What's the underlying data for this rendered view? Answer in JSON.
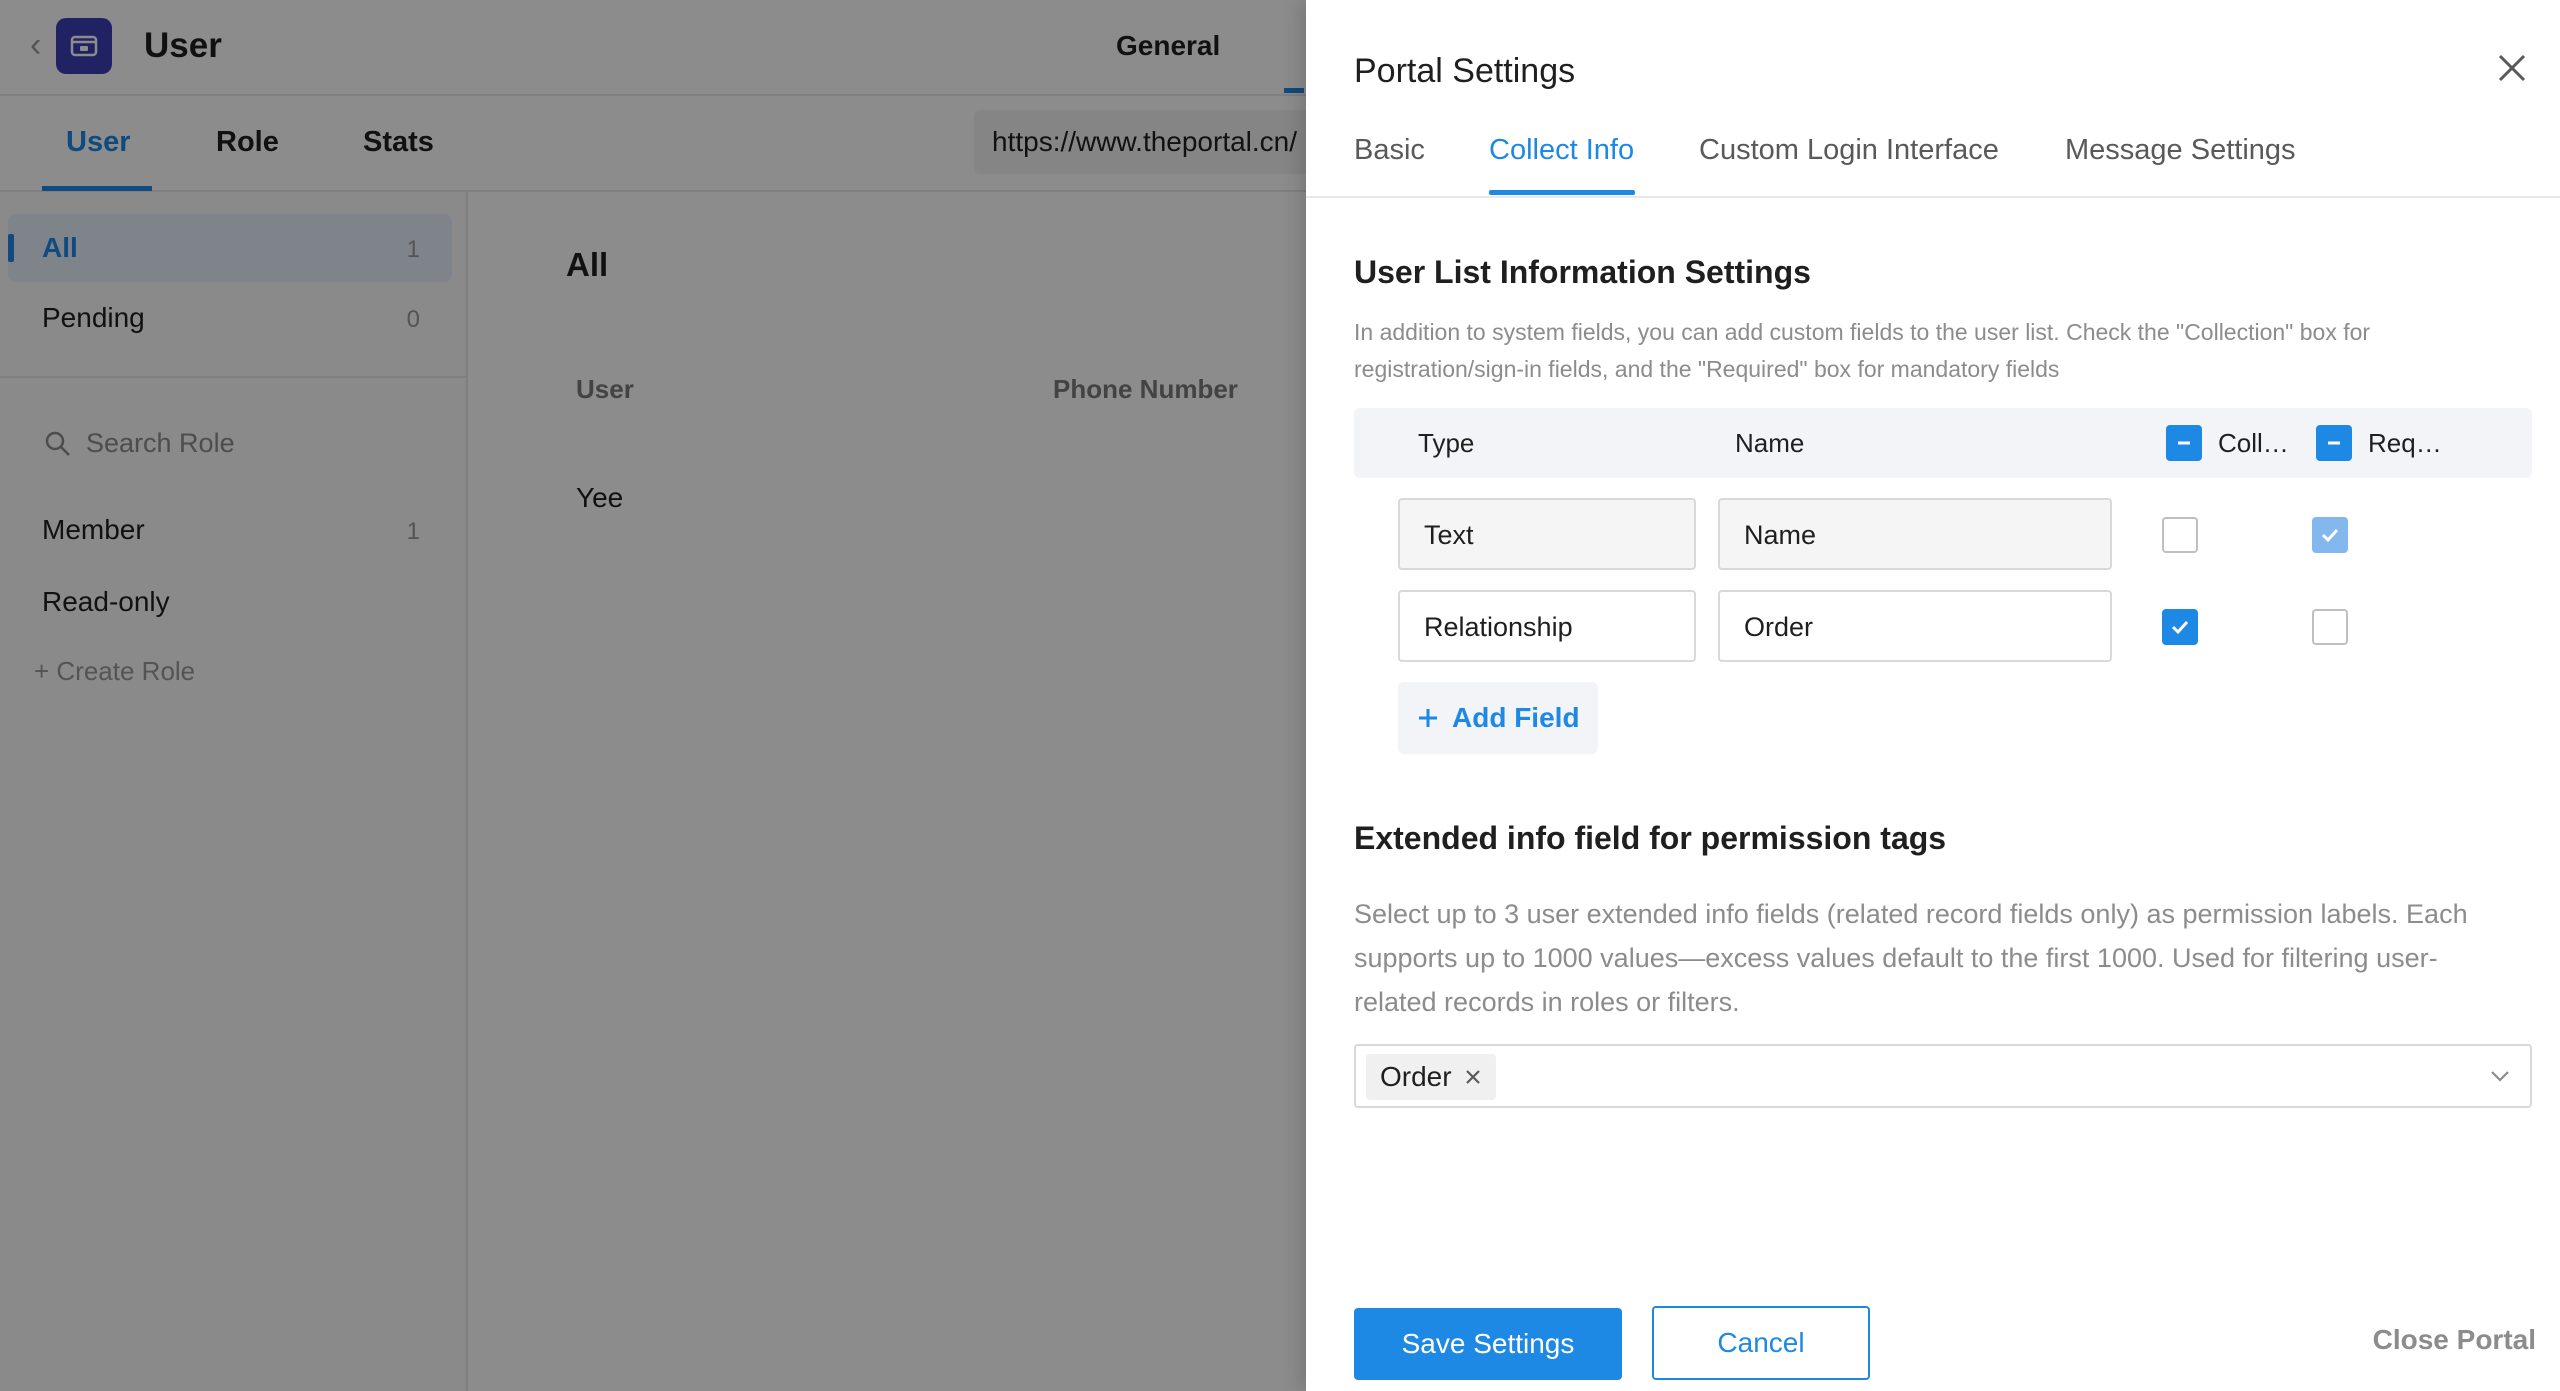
{
  "app": {
    "title": "User",
    "general_label": "General",
    "subtabs": [
      "User",
      "Role",
      "Stats"
    ],
    "url": "https://www.theportal.cn/"
  },
  "sidebar": {
    "items": [
      {
        "label": "All",
        "count": "1"
      },
      {
        "label": "Pending",
        "count": "0"
      }
    ],
    "search_placeholder": "Search Role",
    "roles": [
      {
        "label": "Member",
        "count": "1"
      },
      {
        "label": "Read-only",
        "count": ""
      }
    ],
    "create_role": "+ Create Role"
  },
  "main": {
    "heading": "All",
    "columns": [
      "User",
      "Phone Number"
    ],
    "rows": [
      {
        "user": "Yee"
      }
    ]
  },
  "drawer": {
    "title": "Portal Settings",
    "tabs": [
      "Basic",
      "Collect Info",
      "Custom Login Interface",
      "Message Settings"
    ],
    "active_tab": "Collect Info",
    "section1": {
      "title": "User List Information Settings",
      "description": "In addition to system fields, you can add custom fields to the user list. Check the \"Collection\" box for registration/sign-in fields, and the \"Required\" box for mandatory fields"
    },
    "table": {
      "headers": {
        "type": "Type",
        "name": "Name",
        "collect": "Coll…",
        "required": "Req…"
      },
      "rows": [
        {
          "type": "Text",
          "name": "Name",
          "collect": false,
          "required": true
        },
        {
          "type": "Relationship",
          "name": "Order",
          "collect": true,
          "required": false
        }
      ]
    },
    "add_field": "Add Field",
    "section2": {
      "title": "Extended info field for permission tags",
      "description": "Select up to 3 user extended info fields (related record fields only) as permission labels. Each supports up to 1000 values—excess values default to the first 1000. Used for filtering user-related records in roles or filters."
    },
    "selected_tag": "Order",
    "footer": {
      "save": "Save Settings",
      "cancel": "Cancel",
      "close_portal": "Close Portal"
    }
  },
  "colors": {
    "accent": "#1e88e5",
    "logo": "#3b3fb6",
    "muted_text": "#8c8c8c"
  }
}
